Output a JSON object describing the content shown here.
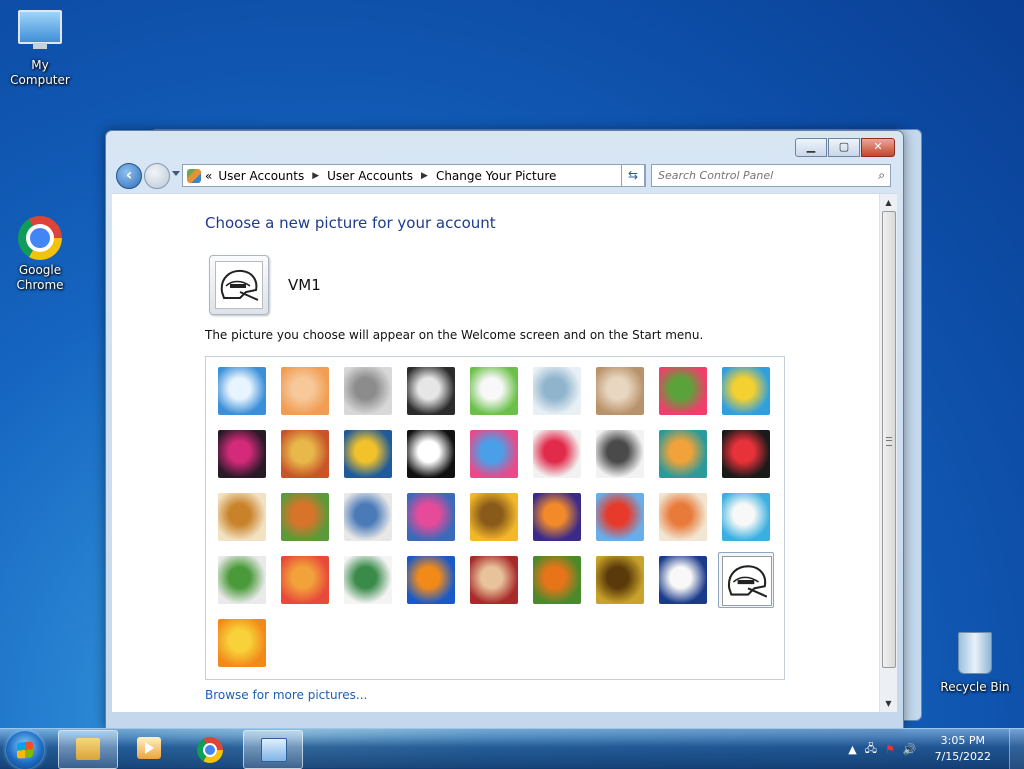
{
  "desktop": {
    "icons": [
      {
        "label": "My Computer",
        "icon": "computer-icon"
      },
      {
        "label": "Google Chrome",
        "icon": "chrome-icon"
      },
      {
        "label": "Recycle Bin",
        "icon": "recycle-bin-icon"
      }
    ]
  },
  "window": {
    "caption_buttons": {
      "minimize": "▁",
      "maximize": "▢",
      "close": "✕"
    },
    "breadcrumb": {
      "overflow": "«",
      "items": [
        "User Accounts",
        "User Accounts",
        "Change Your Picture"
      ]
    },
    "search": {
      "placeholder": "Search Control Panel"
    },
    "heading": "Choose a new picture for your account",
    "username": "VM1",
    "description": "The picture you choose will appear on the Welcome screen and on the Start menu.",
    "browse_link": "Browse for more pictures...",
    "pictures": [
      {
        "name": "roller-coaster",
        "colors": [
          "#3a8fd8",
          "#e8f4ff"
        ]
      },
      {
        "name": "starfish",
        "colors": [
          "#f29d52",
          "#f6c89a"
        ]
      },
      {
        "name": "robot-dog",
        "colors": [
          "#d8d8d8",
          "#8c8c8c"
        ]
      },
      {
        "name": "turntable",
        "colors": [
          "#2b2b2b",
          "#e6e6e6"
        ]
      },
      {
        "name": "lucky-cat",
        "colors": [
          "#6cc04a",
          "#f8f8f8"
        ]
      },
      {
        "name": "gyroscope",
        "colors": [
          "#e8f0f6",
          "#8fb4cc"
        ]
      },
      {
        "name": "kitten",
        "colors": [
          "#b8926a",
          "#e8d6c0"
        ]
      },
      {
        "name": "flower",
        "colors": [
          "#ef3f6a",
          "#5aa33a"
        ]
      },
      {
        "name": "pinwheel",
        "colors": [
          "#2ea0e0",
          "#f4d030"
        ]
      },
      {
        "name": "ball",
        "colors": [
          "#2a1a28",
          "#d42a7a"
        ]
      },
      {
        "name": "fabric",
        "colors": [
          "#c8542a",
          "#e8b84a"
        ]
      },
      {
        "name": "leaf",
        "colors": [
          "#1f5a9a",
          "#f2c22a"
        ]
      },
      {
        "name": "dog",
        "colors": [
          "#111111",
          "#ffffff"
        ]
      },
      {
        "name": "crayons",
        "colors": [
          "#e84a8a",
          "#4aa0e8"
        ]
      },
      {
        "name": "star-lantern",
        "colors": [
          "#f2f2f2",
          "#e22a4a"
        ]
      },
      {
        "name": "jacks",
        "colors": [
          "#f2f2f2",
          "#4a4a4a"
        ]
      },
      {
        "name": "stairs",
        "colors": [
          "#2a9a9a",
          "#f2a23a"
        ]
      },
      {
        "name": "paper-crane",
        "colors": [
          "#1a1a1a",
          "#e8323a"
        ]
      },
      {
        "name": "guitar",
        "colors": [
          "#f2e2c2",
          "#c8822a"
        ]
      },
      {
        "name": "pomeranian",
        "colors": [
          "#5a9a3a",
          "#d8742a"
        ]
      },
      {
        "name": "toy-robot",
        "colors": [
          "#e8e8e8",
          "#4a7ab8"
        ]
      },
      {
        "name": "scarf",
        "colors": [
          "#3a6ab8",
          "#e84a9a"
        ]
      },
      {
        "name": "sunflower",
        "colors": [
          "#f2b82a",
          "#8a5a1a"
        ]
      },
      {
        "name": "fish",
        "colors": [
          "#3a2a8a",
          "#f28a2a"
        ]
      },
      {
        "name": "balloon",
        "colors": [
          "#6aaee8",
          "#e83a2a"
        ]
      },
      {
        "name": "doll",
        "colors": [
          "#f2e6d2",
          "#e87a3a"
        ]
      },
      {
        "name": "sailboat",
        "colors": [
          "#3ab0e0",
          "#f8f8f8"
        ]
      },
      {
        "name": "soccer-ball",
        "colors": [
          "#eaeaea",
          "#4a9a3a"
        ]
      },
      {
        "name": "textile",
        "colors": [
          "#e84a3a",
          "#f2a23a"
        ]
      },
      {
        "name": "marbles",
        "colors": [
          "#f4f4f4",
          "#3a8a4a"
        ]
      },
      {
        "name": "window-frame",
        "colors": [
          "#1a5ac8",
          "#f28a1a"
        ]
      },
      {
        "name": "pattern",
        "colors": [
          "#a82a2a",
          "#e8c29a"
        ]
      },
      {
        "name": "butterfly",
        "colors": [
          "#4a8a2a",
          "#e8741a"
        ]
      },
      {
        "name": "shell",
        "colors": [
          "#c8a22a",
          "#5a3a0a"
        ]
      },
      {
        "name": "lighthouse",
        "colors": [
          "#1a3a8a",
          "#f8f8f8"
        ]
      },
      {
        "name": "racing-helmet",
        "colors": [
          "#ffffff",
          "#111111"
        ],
        "selected": true
      },
      {
        "name": "gerbera",
        "colors": [
          "#f28a1a",
          "#f8d23a"
        ]
      }
    ]
  },
  "taskbar": {
    "clock_time": "3:05 PM",
    "clock_date": "7/15/2022",
    "tray_arrow": "▲"
  }
}
